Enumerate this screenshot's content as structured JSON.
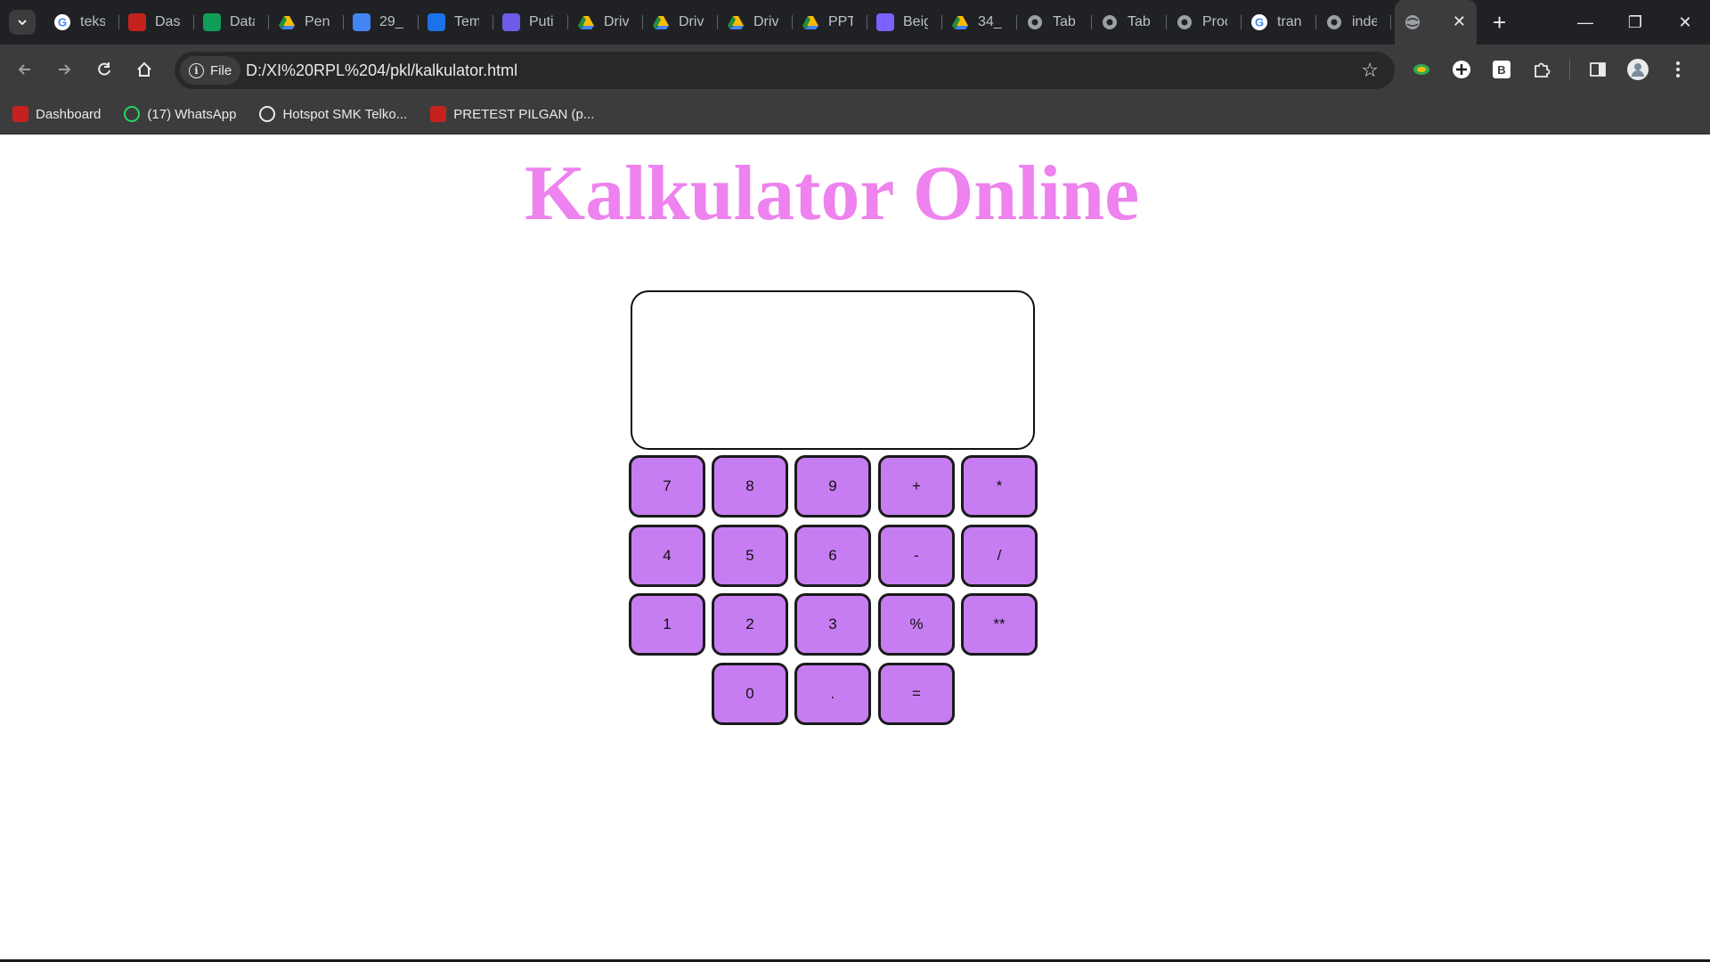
{
  "browser": {
    "tabs": [
      {
        "label": "teks",
        "color": "#ffffff",
        "icon": "google-icon"
      },
      {
        "label": "Das",
        "color": "#c5221f",
        "icon": "dashboard-icon"
      },
      {
        "label": "Data",
        "color": "#0f9d58",
        "icon": "sheets-icon"
      },
      {
        "label": "Pen",
        "color": "#1e8e3e",
        "icon": "drive-icon"
      },
      {
        "label": "29_",
        "color": "#4285f4",
        "icon": "docs-icon"
      },
      {
        "label": "Tem",
        "color": "#1a73e8",
        "icon": "canva-icon"
      },
      {
        "label": "Puti",
        "color": "#6c5ce7",
        "icon": "printer-icon"
      },
      {
        "label": "Driv",
        "color": "#1e8e3e",
        "icon": "drive-icon"
      },
      {
        "label": "Driv",
        "color": "#1e8e3e",
        "icon": "drive-icon"
      },
      {
        "label": "Driv",
        "color": "#1e8e3e",
        "icon": "drive-icon"
      },
      {
        "label": "PPT",
        "color": "#1e8e3e",
        "icon": "drive-icon"
      },
      {
        "label": "Beig",
        "color": "#7b61ff",
        "icon": "app-icon"
      },
      {
        "label": "34_",
        "color": "#1e8e3e",
        "icon": "drive-icon"
      },
      {
        "label": "Tab",
        "color": "#9aa0a6",
        "icon": "chrome-icon"
      },
      {
        "label": "Tab",
        "color": "#9aa0a6",
        "icon": "chrome-icon"
      },
      {
        "label": "Proc",
        "color": "#9aa0a6",
        "icon": "globe-icon"
      },
      {
        "label": "tran",
        "color": "#ffffff",
        "icon": "google-icon"
      },
      {
        "label": "inde",
        "color": "#9aa0a6",
        "icon": "globe-icon"
      }
    ],
    "active_tab": {
      "label": "",
      "icon": "globe-icon",
      "close": "✕"
    },
    "new_tab": "+",
    "window_controls": {
      "minimize": "—",
      "restore": "❐",
      "close": "✕"
    },
    "address": {
      "chip_label": "File",
      "url": "D:/XI%20RPL%204/pkl/kalkulator.html"
    },
    "bookmarks": [
      {
        "label": "Dashboard",
        "color": "#c5221f",
        "icon": "dashboard-icon"
      },
      {
        "label": "(17) WhatsApp",
        "color": "#25d366",
        "icon": "whatsapp-icon"
      },
      {
        "label": "Hotspot SMK Telko...",
        "color": "#e8eaed",
        "icon": "hotspot-icon"
      },
      {
        "label": "PRETEST PILGAN (p...",
        "color": "#c5221f",
        "icon": "dashboard-icon"
      }
    ]
  },
  "page": {
    "title": "Kalkulator Online",
    "display_value": "",
    "accent_color": "#ee82ee",
    "key_color": "#c77df2",
    "keys": [
      {
        "label": "7",
        "name": "key-7"
      },
      {
        "label": "8",
        "name": "key-8"
      },
      {
        "label": "9",
        "name": "key-9"
      },
      {
        "label": "+",
        "name": "key-plus"
      },
      {
        "label": "*",
        "name": "key-multiply"
      },
      {
        "label": "4",
        "name": "key-4"
      },
      {
        "label": "5",
        "name": "key-5"
      },
      {
        "label": "6",
        "name": "key-6"
      },
      {
        "label": "-",
        "name": "key-minus"
      },
      {
        "label": "/",
        "name": "key-divide"
      },
      {
        "label": "1",
        "name": "key-1"
      },
      {
        "label": "2",
        "name": "key-2"
      },
      {
        "label": "3",
        "name": "key-3"
      },
      {
        "label": "%",
        "name": "key-modulo"
      },
      {
        "label": "**",
        "name": "key-power"
      },
      {
        "label": "0",
        "name": "key-0"
      },
      {
        "label": ".",
        "name": "key-decimal"
      },
      {
        "label": "=",
        "name": "key-equals"
      }
    ]
  }
}
